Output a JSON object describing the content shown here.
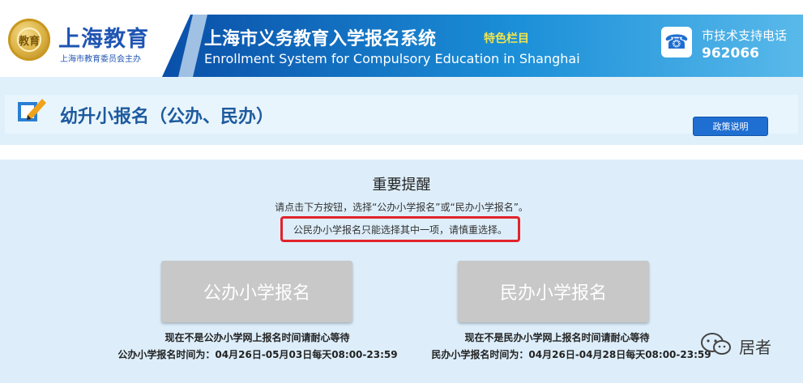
{
  "header": {
    "brand_name": "上海教育",
    "brand_sub": "上海市教育委员会主办",
    "emblem_text": "教育",
    "system_title": "上海市义务教育入学报名系统",
    "system_tag": "特色栏目",
    "system_title_en": "Enrollment System for Compulsory Education in Shanghai",
    "support_label": "市技术支持电话",
    "support_number": "962066",
    "phone_icon": "☎"
  },
  "page": {
    "title": "幼升小报名（公办、民办）",
    "policy_button": "政策说明"
  },
  "notice": {
    "title": "重要提醒",
    "instruction": "请点击下方按钮，选择“公办小学报名”或“民办小学报名”。",
    "warning": "公民办小学报名只能选择其中一项，请慎重选择。"
  },
  "options": {
    "public": {
      "button_label": "公办小学报名",
      "status": "现在不是公办小学网上报名时间请耐心等待",
      "time": "公办小学报名时间为：04月26日-05月03日每天08:00-23:59"
    },
    "private": {
      "button_label": "民办小学报名",
      "status": "现在不是民办小学网上报名时间请耐心等待",
      "time": "民办小学报名时间为：04月26日-04月28日每天08:00-23:59"
    }
  },
  "watermark": {
    "text": "居者",
    "icon": "wechat-icon"
  },
  "colors": {
    "brand_blue": "#1f55b3",
    "banner_blue": "#0a4fa8",
    "accent_yellow": "#f4e64a",
    "warning_red": "#e2232b",
    "button_disabled": "#c8c8c8"
  }
}
